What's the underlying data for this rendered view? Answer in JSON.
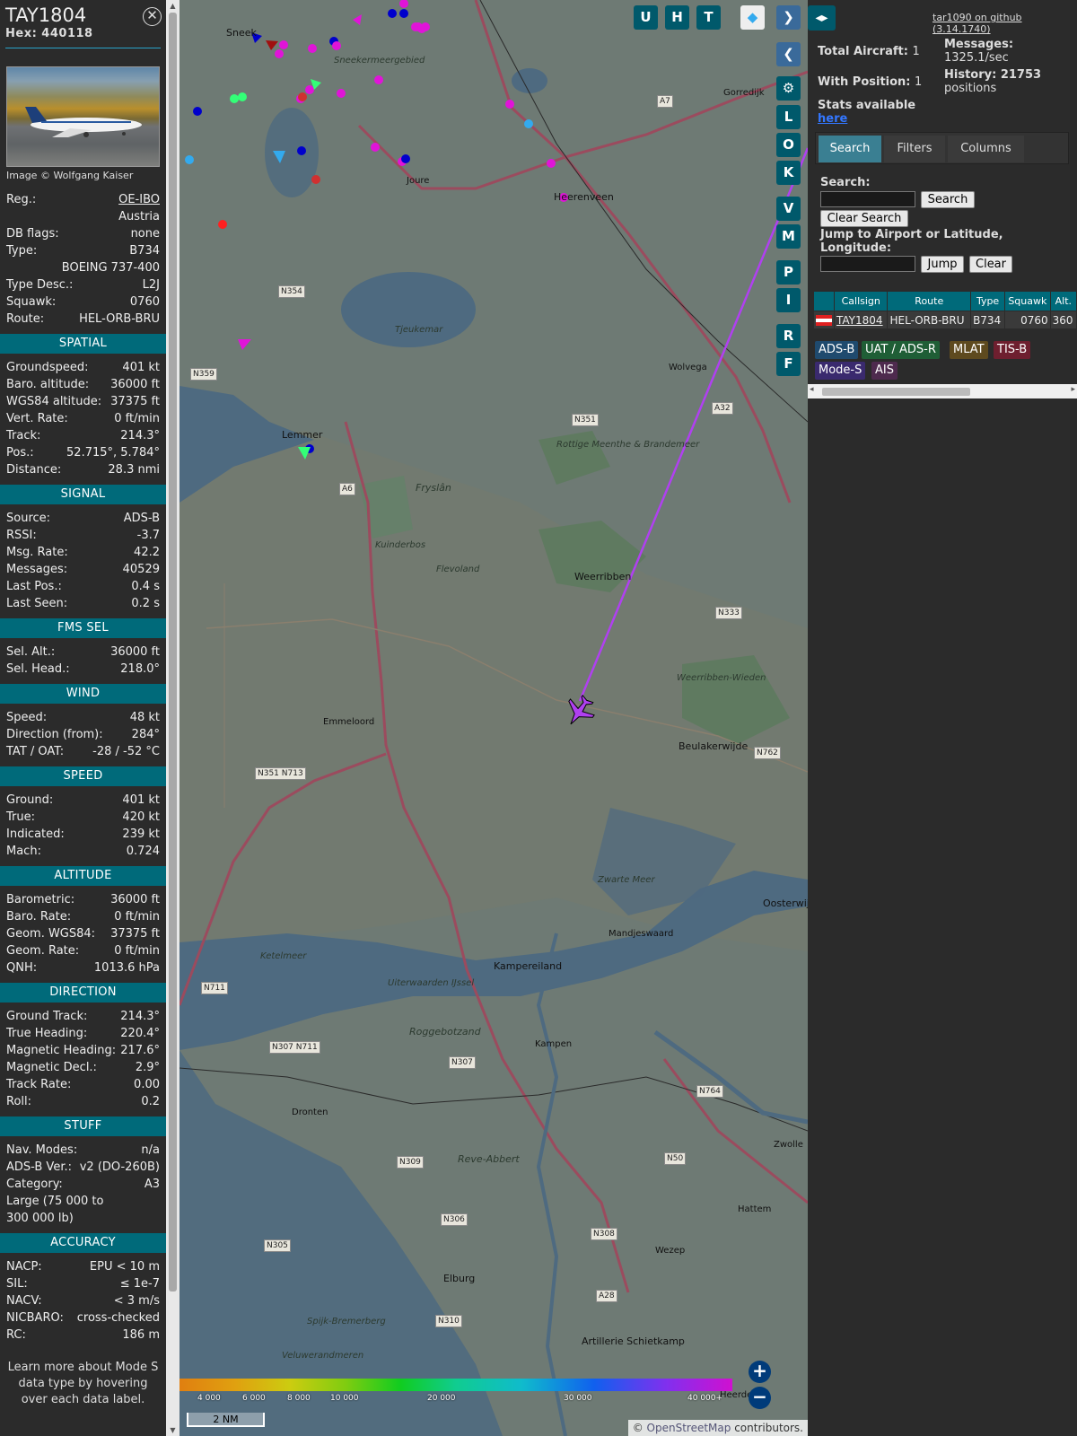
{
  "sidebar": {
    "callsign": "TAY1804",
    "hex": "Hex: 440118",
    "image_credit": "Image © Wolfgang Kaiser",
    "info": [
      {
        "label": "Reg.:",
        "value": "OE-IBO"
      },
      {
        "label": "",
        "value": "Austria"
      },
      {
        "label": "DB flags:",
        "value": "none"
      },
      {
        "label": "Type:",
        "value": "B734"
      },
      {
        "label": "",
        "value": "BOEING 737-400"
      },
      {
        "label": "Type Desc.:",
        "value": "L2J"
      },
      {
        "label": "Squawk:",
        "value": "0760"
      },
      {
        "label": "Route:",
        "value": "HEL-ORB-BRU"
      }
    ],
    "sections": [
      {
        "title": "SPATIAL",
        "rows": [
          {
            "label": "Groundspeed:",
            "value": "401 kt"
          },
          {
            "label": "Baro. altitude:",
            "value": "36000 ft"
          },
          {
            "label": "WGS84 altitude:",
            "value": "37375 ft"
          },
          {
            "label": "Vert. Rate:",
            "value": "0 ft/min"
          },
          {
            "label": "Track:",
            "value": "214.3°"
          },
          {
            "label": "Pos.:",
            "value": "52.715°, 5.784°"
          },
          {
            "label": "Distance:",
            "value": "28.3 nmi"
          }
        ]
      },
      {
        "title": "SIGNAL",
        "rows": [
          {
            "label": "Source:",
            "value": "ADS-B"
          },
          {
            "label": "RSSI:",
            "value": "-3.7"
          },
          {
            "label": "Msg. Rate:",
            "value": "42.2"
          },
          {
            "label": "Messages:",
            "value": "40529"
          },
          {
            "label": "Last Pos.:",
            "value": "0.4 s"
          },
          {
            "label": "Last Seen:",
            "value": "0.2 s"
          }
        ]
      },
      {
        "title": "FMS SEL",
        "rows": [
          {
            "label": "Sel. Alt.:",
            "value": "36000 ft"
          },
          {
            "label": "Sel. Head.:",
            "value": "218.0°"
          }
        ]
      },
      {
        "title": "WIND",
        "rows": [
          {
            "label": "Speed:",
            "value": "48 kt"
          },
          {
            "label": "Direction (from):",
            "value": "284°"
          },
          {
            "label": "TAT / OAT:",
            "value": "-28 / -52 °C"
          }
        ]
      },
      {
        "title": "SPEED",
        "rows": [
          {
            "label": "Ground:",
            "value": "401 kt"
          },
          {
            "label": "True:",
            "value": "420 kt"
          },
          {
            "label": "Indicated:",
            "value": "239 kt"
          },
          {
            "label": "Mach:",
            "value": "0.724"
          }
        ]
      },
      {
        "title": "ALTITUDE",
        "rows": [
          {
            "label": "Barometric:",
            "value": "36000 ft"
          },
          {
            "label": "Baro. Rate:",
            "value": "0 ft/min"
          },
          {
            "label": "Geom. WGS84:",
            "value": "37375 ft"
          },
          {
            "label": "Geom. Rate:",
            "value": "0 ft/min"
          },
          {
            "label": "QNH:",
            "value": "1013.6 hPa"
          }
        ]
      },
      {
        "title": "DIRECTION",
        "rows": [
          {
            "label": "Ground Track:",
            "value": "214.3°"
          },
          {
            "label": "True Heading:",
            "value": "220.4°"
          },
          {
            "label": "Magnetic Heading:",
            "value": "217.6°"
          },
          {
            "label": "Magnetic Decl.:",
            "value": "2.9°"
          },
          {
            "label": "Track Rate:",
            "value": "0.00"
          },
          {
            "label": "Roll:",
            "value": "0.2"
          }
        ]
      },
      {
        "title": "STUFF",
        "rows": [
          {
            "label": "Nav. Modes:",
            "value": "n/a"
          },
          {
            "label": "ADS-B Ver.:",
            "value": "v2 (DO-260B)"
          },
          {
            "label": "Category:",
            "value": "A3"
          },
          {
            "label": "Large (75 000 to 300 000 lb)",
            "value": ""
          }
        ]
      },
      {
        "title": "ACCURACY",
        "rows": [
          {
            "label": "NACP:",
            "value": "EPU < 10 m"
          },
          {
            "label": "SIL:",
            "value": "≤ 1e-7"
          },
          {
            "label": "NACV:",
            "value": "< 3 m/s"
          },
          {
            "label": "NICBARO:",
            "value": "cross-checked"
          },
          {
            "label": "RC:",
            "value": "186 m"
          }
        ]
      }
    ],
    "note": "Learn more about Mode S data type by hovering over each data label."
  },
  "map": {
    "buttons_top": [
      "U",
      "H",
      "T"
    ],
    "buttons_side": [
      "L",
      "O",
      "K",
      "V",
      "M",
      "P",
      "I",
      "R",
      "F"
    ],
    "places": [
      "Sneek",
      "Sneekermeergebied",
      "Joure",
      "Heerenveen",
      "Gorredijk",
      "Wolvega",
      "Lemmer",
      "Tjeukemar",
      "Rottige Meenthe & Brandemeer",
      "Fryslân",
      "Kuinderbos",
      "Flevoland",
      "Weerribben",
      "Weerribben-Wieden",
      "Emmeloord",
      "Beulakerwijde",
      "Zwarte Meer",
      "Mandjeswaard",
      "Kampereiland",
      "Ketelmeer",
      "Uiterwaarden IJssel",
      "Roggebotzand",
      "Kampen",
      "Dronten",
      "Reve-Abbert",
      "Hattem",
      "Wezep",
      "Elburg",
      "Spijk-Bremerberg",
      "Veluwerandmeren",
      "Artillerie Schietkamp",
      "Heerde",
      "Zwolle",
      "Oosterwijk"
    ],
    "roads": [
      "A7",
      "N354",
      "N359",
      "A6",
      "N351",
      "A32",
      "N333",
      "N762",
      "N351 N713",
      "N711",
      "N307 N711",
      "N307",
      "N764",
      "N309",
      "N50",
      "N306",
      "N308",
      "N305",
      "A28",
      "N310"
    ],
    "colorbar_labels": [
      "4 000",
      "6 000",
      "8 000",
      "10 000",
      "20 000",
      "30 000",
      "40 000+"
    ],
    "scale": "2 NM",
    "attribution_prefix": "© ",
    "attribution_link": "OpenStreetMap",
    "attribution_suffix": " contributors."
  },
  "panel": {
    "github": "tar1090 on github (3.14.1740)",
    "total_aircraft": "Total Aircraft: ",
    "total_aircraft_val": "1",
    "with_position": "With Position: ",
    "with_position_val": "1",
    "stats": "Stats available ",
    "stats_link": "here",
    "messages": "Messages:",
    "messages_val": "1325.1/sec",
    "history": "History: 21753",
    "history_val": "positions",
    "tabs": [
      "Search",
      "Filters",
      "Columns"
    ],
    "search_label": "Search:",
    "search_btn": "Search",
    "clear_search_btn": "Clear Search",
    "jump_label": "Jump to Airport or Latitude, Longitude:",
    "jump_btn": "Jump",
    "clear_btn": "Clear",
    "columns": [
      "Callsign",
      "Route",
      "Type",
      "Squawk",
      "Alt."
    ],
    "row": {
      "callsign": "TAY1804",
      "route": "HEL-ORB-BRU",
      "type": "B734",
      "squawk": "0760",
      "alt": "360"
    },
    "legend": [
      "ADS-B",
      "UAT / ADS-R",
      "MLAT",
      "TIS-B",
      "Mode-S",
      "AIS"
    ],
    "colors": {
      "accent": "#006a7a",
      "track": "#b040f0",
      "adsb": "#1f4a6e",
      "uat": "#1f5e36",
      "mlat": "#5e4a1f",
      "tisb": "#6e1f2f",
      "modes": "#3a2a6e",
      "ais": "#4e2a4e"
    }
  }
}
